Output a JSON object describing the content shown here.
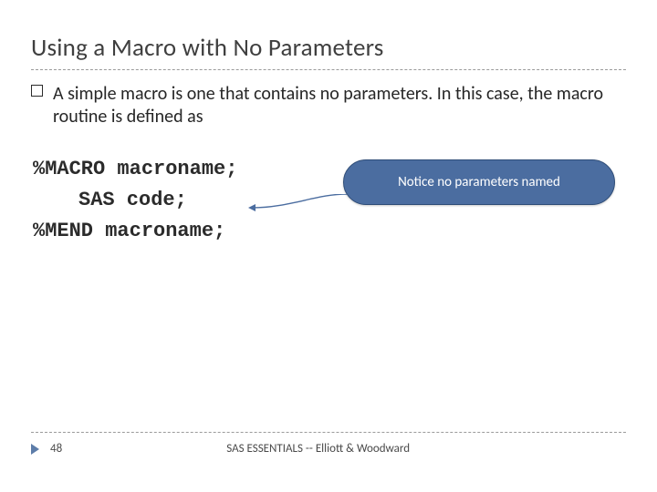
{
  "title": "Using a Macro with No Parameters",
  "body": "A simple macro is one that contains no parameters. In this case, the macro routine is defined as",
  "code": {
    "line1": "%MACRO macroname;",
    "line2": "SAS code;",
    "line3": "%MEND macroname;"
  },
  "callout": "Notice no parameters named",
  "footer": {
    "page": "48",
    "text": "SAS ESSENTIALS -- Elliott & Woodward"
  }
}
